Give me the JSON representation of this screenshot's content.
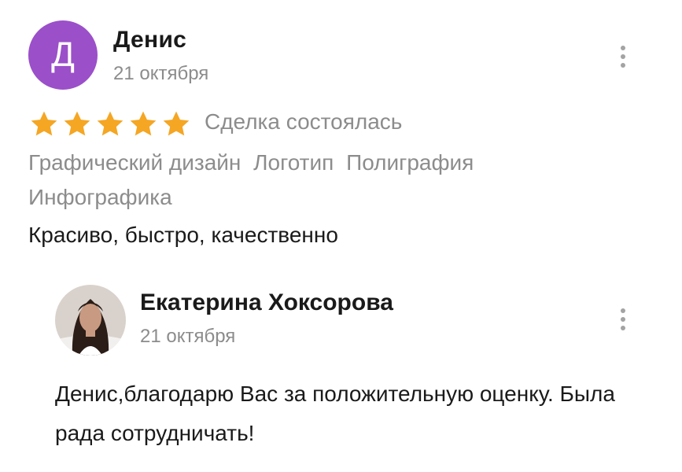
{
  "review": {
    "avatar_letter": "Д",
    "avatar_color": "#9b4fc9",
    "author": "Денис",
    "date": "21 октября",
    "rating": 5,
    "rating_max": 5,
    "star_color": "#f5a623",
    "status": "Сделка состоялась",
    "tags": [
      "Графический дизайн",
      "Логотип",
      "Полиграфия",
      "Инфографика"
    ],
    "text": "Красиво, быстро, качественно",
    "menu_icon": "more-vertical-icon"
  },
  "reply": {
    "author": "Екатерина Хоксорова",
    "date": "21 октября",
    "text": "Денис,благодарю Вас за положительную оценку. Была рада сотрудничать!",
    "menu_icon": "more-vertical-icon"
  }
}
